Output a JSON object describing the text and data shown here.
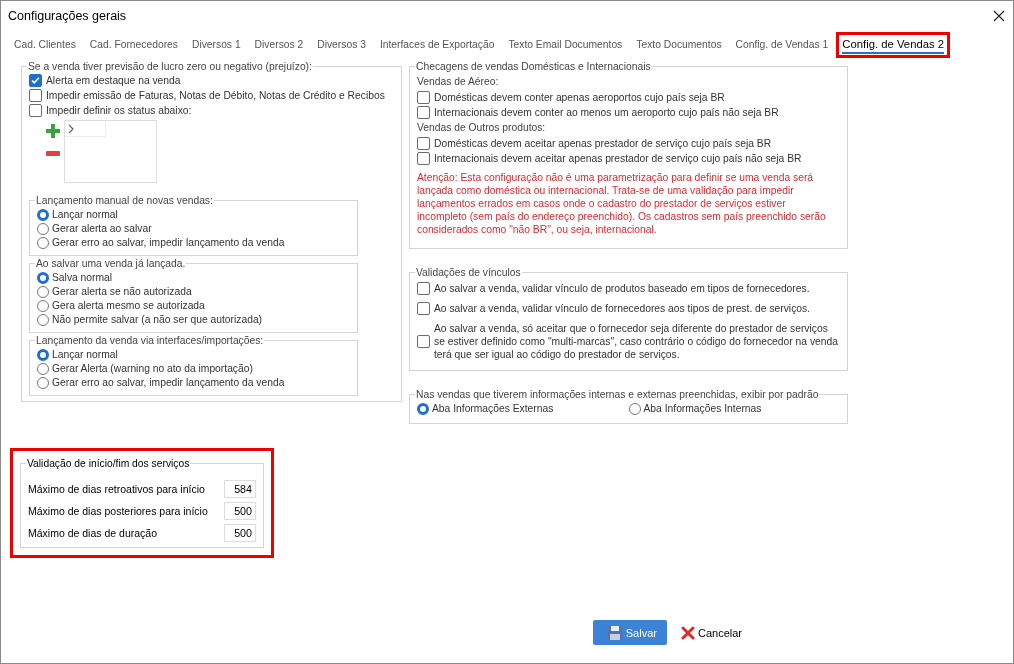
{
  "window": {
    "title": "Configurações gerais"
  },
  "tabs": [
    {
      "label": "Cad. Clientes",
      "selected": false,
      "highlighted": false
    },
    {
      "label": "Cad. Fornecedores",
      "selected": false,
      "highlighted": false
    },
    {
      "label": "Diversos 1",
      "selected": false,
      "highlighted": false
    },
    {
      "label": "Diversos 2",
      "selected": false,
      "highlighted": false
    },
    {
      "label": "Diversos 3",
      "selected": false,
      "highlighted": false
    },
    {
      "label": "Interfaces de Exportação",
      "selected": false,
      "highlighted": false
    },
    {
      "label": "Texto Email Documentos",
      "selected": false,
      "highlighted": false
    },
    {
      "label": "Texto Documentos",
      "selected": false,
      "highlighted": false
    },
    {
      "label": "Config. de Vendas 1",
      "selected": false,
      "highlighted": false
    },
    {
      "label": "Config. de Vendas 2",
      "selected": true,
      "highlighted": true
    }
  ],
  "profit_group": {
    "title": "Se a venda tiver previsão de lucro zero ou negativo (prejuízo):",
    "options": [
      {
        "label": "Alerta em destaque na venda",
        "checked": true
      },
      {
        "label": "Impedir emissão de Faturas, Notas de Débito, Notas de Crédito e Recibos",
        "checked": false
      },
      {
        "label": "Impedir definir os status abaixo:",
        "checked": false
      }
    ],
    "radio_groups": [
      {
        "title": "Lançamento manual de novas vendas:",
        "options": [
          {
            "label": "Lançar normal",
            "selected": true
          },
          {
            "label": "Gerar alerta ao salvar",
            "selected": false
          },
          {
            "label": "Gerar erro ao salvar, impedir lançamento da venda",
            "selected": false
          }
        ]
      },
      {
        "title": "Ao salvar uma venda já lançada.",
        "options": [
          {
            "label": "Salva normal",
            "selected": true
          },
          {
            "label": "Gerar alerta se não autorizada",
            "selected": false
          },
          {
            "label": "Gera alerta mesmo se autorizada",
            "selected": false
          },
          {
            "label": "Não permite salvar (a não ser que autorizada)",
            "selected": false
          }
        ]
      },
      {
        "title": "Lançamento da venda via interfaces/importações:",
        "options": [
          {
            "label": "Lançar normal",
            "selected": true
          },
          {
            "label": "Gerar Alerta (warning no ato da importação)",
            "selected": false
          },
          {
            "label": "Gerar erro ao salvar, impedir lançamento da venda",
            "selected": false
          }
        ]
      }
    ]
  },
  "checks_group": {
    "title": "Checagens de vendas Domésticas e Internacionais",
    "sections": [
      {
        "heading": "Vendas de Aéreo:",
        "options": [
          {
            "label": "Domésticas devem conter apenas aeroportos cujo país seja BR",
            "checked": false
          },
          {
            "label": "Internacionais devem conter ao menos um aeroporto cujo país não seja BR",
            "checked": false
          }
        ]
      },
      {
        "heading": "Vendas de Outros produtos:",
        "options": [
          {
            "label": "Domésticas devem aceitar apenas prestador de serviço cujo país seja BR",
            "checked": false
          },
          {
            "label": "Internacionais devem aceitar apenas prestador de serviço cujo país não seja BR",
            "checked": false
          }
        ]
      }
    ],
    "warning": "Atenção: Esta configuração não é uma parametrização para definir se uma venda será lançada como doméstica ou internacional. Trata-se de uma validação para impedir lançamentos errados em casos onde o cadastro do prestador de serviços estiver incompleto (sem país do endereço preenchido). Os cadastros sem país preenchido serão considerados como \"não BR\", ou seja, internacional."
  },
  "links_group": {
    "title": "Validações de vínculos",
    "options": [
      {
        "label": "Ao salvar a venda, validar vínculo de produtos baseado em tipos de fornecedores.",
        "checked": false
      },
      {
        "label": "Ao salvar a venda, validar vínculo de fornecedores aos tipos de prest. de serviços.",
        "checked": false
      },
      {
        "label": "Ao salvar a venda, só aceitar que o fornecedor seja diferente do prestador de serviços se estiver definido como \"multi-marcas\", caso contrário o código do fornecedor na venda terá que ser igual ao código do prestador de serviços.",
        "checked": false
      }
    ]
  },
  "default_tab_group": {
    "title": "Nas vendas que tiverem informações internas e externas preenchidas, exibir por padrão",
    "options": [
      {
        "label": "Aba Informações Externas",
        "selected": true
      },
      {
        "label": "Aba Informações Internas",
        "selected": false
      }
    ]
  },
  "services_group": {
    "title": "Validação de início/fim dos serviços",
    "highlighted": true,
    "fields": [
      {
        "label": "Máximo de dias retroativos para início",
        "value": "584"
      },
      {
        "label": "Máximo de dias posteriores para início",
        "value": "500"
      },
      {
        "label": "Máximo de dias de duração",
        "value": "500"
      }
    ]
  },
  "buttons": [
    {
      "label": "Salvar",
      "kind": "primary"
    },
    {
      "label": "Cancelar",
      "kind": "cancel"
    }
  ]
}
